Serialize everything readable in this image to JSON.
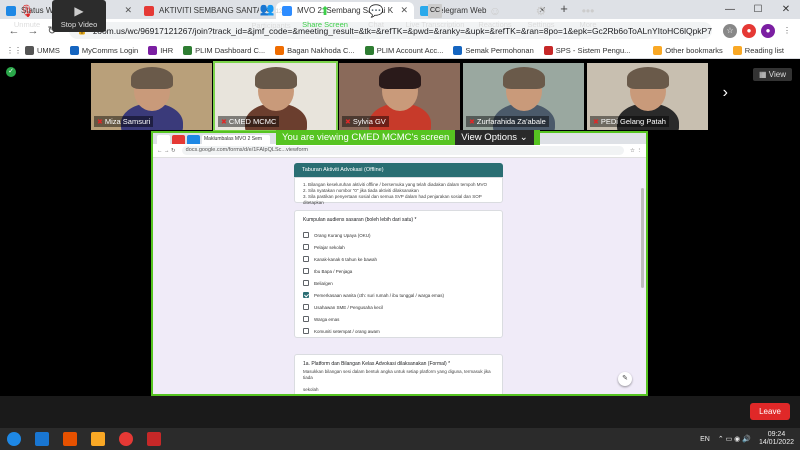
{
  "browser": {
    "tabs": [
      {
        "label": "Status WK",
        "favicon_color": "#1e88e5",
        "active": false
      },
      {
        "label": "AKTIVITI SEMBANG SANTAI BER",
        "favicon_color": "#e53935",
        "active": false
      },
      {
        "label": "MVO 2: Sembang Santai K",
        "favicon_color": "#2d8cff",
        "active": true
      },
      {
        "label": "Telegram Web",
        "favicon_color": "#29a9eb",
        "active": false
      }
    ],
    "new_tab_label": "+",
    "url": "zoom.us/wc/96917121267/join?track_id=&jmf_code=&meeting_result=&tk=&refTK=&pwd=&ranky=&upk=&refTK=&ran=8po=1&epk=Gc2Rb6oToALnYItoHC6lQpkP79l5C...",
    "bookmarks": [
      {
        "label": "UMMS",
        "color": "#555"
      },
      {
        "label": "MyComms Login",
        "color": "#1565c0"
      },
      {
        "label": "IHR",
        "color": "#7b1fa2"
      },
      {
        "label": "PLIM Dashboard C...",
        "color": "#2e7d32"
      },
      {
        "label": "Bagan Nakhoda C...",
        "color": "#ef6c00"
      },
      {
        "label": "PLIM Account Acc...",
        "color": "#2e7d32"
      },
      {
        "label": "Semak Permohonan",
        "color": "#1565c0"
      },
      {
        "label": "SPS - Sistem Pengu...",
        "color": "#c62828"
      }
    ],
    "bookmarks_right": [
      "Other bookmarks",
      "Reading list"
    ]
  },
  "zoom": {
    "participants": [
      {
        "name": "Miza Samsuri",
        "bg": "#b9a07a",
        "shirt": "#3a3a7a",
        "muted": true
      },
      {
        "name": "CMED MCMC",
        "bg": "#e8e4dc",
        "shirt": "#6b3e2e",
        "muted": true,
        "speaking": true
      },
      {
        "name": "Sylvia GV",
        "bg": "#8a6a5a",
        "shirt": "#c73a2a",
        "muted": true
      },
      {
        "name": "Zurfarahida Za'abale",
        "bg": "#9aa8a0",
        "shirt": "#4b5a6a",
        "muted": true
      },
      {
        "name": "PEDi Gelang Patah",
        "bg": "#c8bfb0",
        "shirt": "#2a2a2a",
        "muted": true
      }
    ],
    "view_label": "View",
    "banner_text": "You are viewing CMED MCMC's screen",
    "view_options_label": "View Options",
    "shared_screen": {
      "mini_tab": "Maklumbalas MVO 2 Sem",
      "url": "docs.google.com/forms/d/e/1FAIpQLSc...viewform",
      "section_title": "Taburan Aktiviti Advokasi (Offline)",
      "instructions": [
        "1. Bilangan keseluruhan aktiviti offline / bersemuka yang telah diadakan dalam tempoh MVO",
        "2. Sila nyatakan nombor \"0\" jika tiada aktiviti dilaksanakan",
        "3. Sila pastikan penyertaan sosial dan semua SVP dalam had penjarakan sosial dan SOP ditetapkan"
      ],
      "question1": "Kumpulan audiens sasaran (boleh lebih dari satu) *",
      "options": [
        {
          "label": "Orang Kurang Upaya (OKU)",
          "checked": false
        },
        {
          "label": "Pelajar sekolah",
          "checked": false
        },
        {
          "label": "Kanak-kanak 6 tahun ke bawah",
          "checked": false
        },
        {
          "label": "Ibu Bapa / Penjaga",
          "checked": false
        },
        {
          "label": "Belia/gen",
          "checked": false
        },
        {
          "label": "Pemerkasaan wanita (cth: suri rumah / ibu tunggal / warga emas)",
          "checked": true
        },
        {
          "label": "Usahawan SME / Pengusaha kecil",
          "checked": false
        },
        {
          "label": "Warga emas",
          "checked": false
        },
        {
          "label": "Komuniti setempat / orang awam",
          "checked": false
        }
      ],
      "question2": "1a. Platform dan Bilangan Kelas Advokasi dilaksanakan (Formal) *",
      "question2_hint": "Masukkan bilangan sesi dalam bentuk angka untuk setiap platform yang diguna, termasuk jika tiada",
      "question2_field": "sekolah"
    },
    "toolbar": {
      "unmute": "Unmute",
      "stop_video": "Stop Video",
      "participants": "Participants",
      "participants_count": "12",
      "share_screen": "Share Screen",
      "chat": "Chat",
      "live_transcription": "Live Transcription",
      "reactions": "Reactions",
      "settings": "Settings",
      "more": "More",
      "leave": "Leave"
    }
  },
  "taskbar": {
    "apps": [
      {
        "name": "windows-start",
        "color": "#1e88e5"
      },
      {
        "name": "internet-explorer",
        "color": "#1976d2"
      },
      {
        "name": "media-player",
        "color": "#e65100"
      },
      {
        "name": "file-explorer",
        "color": "#f9a825"
      },
      {
        "name": "chrome",
        "color": "#e53935"
      },
      {
        "name": "photos",
        "color": "#c62828"
      }
    ],
    "language": "EN",
    "time": "09:24",
    "date": "14/01/2022"
  }
}
